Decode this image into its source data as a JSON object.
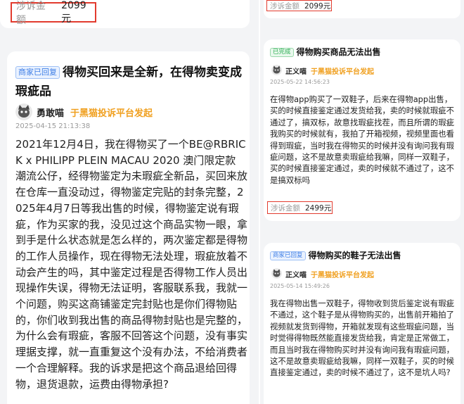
{
  "left": {
    "top_amount": {
      "label": "涉诉金额",
      "value": "2099元"
    },
    "complaint": {
      "badge": "商家已回复",
      "title": "得物买回来是全新，在得物卖变成瑕疵品",
      "user": "勇敢喵",
      "platform": "于黑猫投诉平台发起",
      "timestamp": "2025-04-15 21:13:38",
      "body": "2021年12月4日，我在得物买了一个BE@RBRICK x PHILIPP PLEIN MACAU 2020 澳门限定款 潮流公仔，经得物鉴定为未瑕疵全新品，买回来放在仓库一直没动过，得物鉴定完贴的封条完整，2025年4月7日等我出售的时候，得物鉴定说有瑕疵，作为买家的我，没见过这个商品实物一眼，拿到手是什么状态就是怎么样的，两次鉴定都是得物的工作人员操作，现在得物无法处理，瑕疵放着不动会产生的吗，其中鉴定过程是否得物工作人员出现操作失误，得物无法证明，客服联系我，我就一个问题，购买这商铺鉴定完封贴也是你们得物贴的，你们收到我出售的商品得物封贴也是完整的，为什么会有瑕疵，客服不回答这个问题，没有事实理据支撑，就一直重复这个没有办法，不给消费者一个合理解释。我的诉求是把这个商品退给回得物，退货退款，运费由得物承担?"
    }
  },
  "right": {
    "top_amount": {
      "label": "涉诉金额",
      "value": "2099元"
    },
    "complaint1": {
      "badge": "已完成",
      "title": "得物购买商品无法出售",
      "user": "正义喵",
      "platform": "于黑猫投诉平台发起",
      "timestamp": "2025-05-22 14:56:23",
      "body": "在得物app购买了一双鞋子，后来在得物app出售，买的时候直接鉴定通过发货给我，卖的时候就瑕疵不通过了，搞双标，故意找瑕疵找茬，而且所谓的瑕疵我购买的时候就有，我拍了开箱视频，视频里面也看得到瑕疵，当时我在得物买的时候并没有询问我有瑕疵问题，这不是故意卖瑕疵给我嘛，同样一双鞋子，买的时候直接鉴定通过，卖的时候就不通过了，这不是搞双标吗",
      "amount_label": "涉诉金额",
      "amount_value": "2499元"
    },
    "complaint2": {
      "badge": "商家已回复",
      "title": "得物购买的鞋子无法出售",
      "user": "正义喵",
      "platform": "于黑猫投诉平台发起",
      "timestamp": "2025-05-14 15:49:26",
      "body": "我在得物出售一双鞋子，得物收到货后鉴定说有瑕疵不通过，这个鞋子是从得物购买的，出售前开箱拍了视频就发货到得物，开箱就发现有这些瑕疵问题，当时觉得得物既然能直接发货给我，肯定是正常做工，而且当时我在得物购买时并没有询问我有瑕疵问题，这不是故意卖瑕疵给我嘛，同样一双鞋子，买的时候直接鉴定通过，卖的时候不通过了，这不是坑人吗?"
    }
  },
  "colors": {
    "highlight_border": "#e23b2e",
    "platform": "#f0a020",
    "reply_badge": "#3f7fe6",
    "done_badge": "#2fae55"
  }
}
